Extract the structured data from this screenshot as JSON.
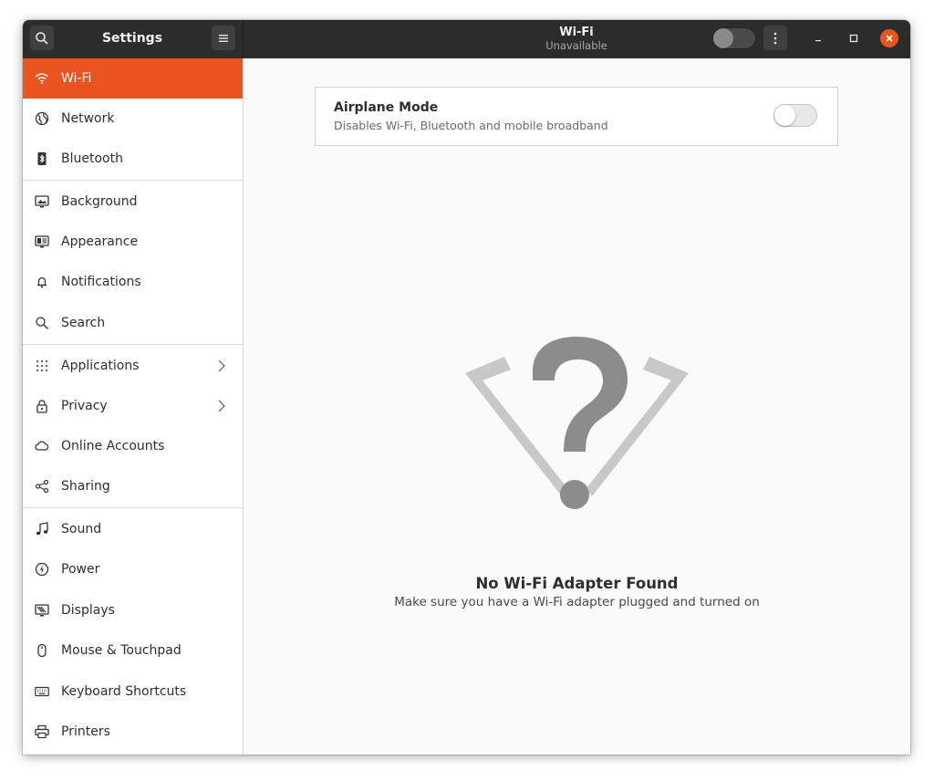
{
  "header": {
    "sidebar_title": "Settings",
    "title": "Wi-Fi",
    "subtitle": "Unavailable",
    "wifi_toggle_on": false,
    "icons": [
      "search-icon",
      "hamburger-menu-icon",
      "kebab-menu-icon",
      "minimize-icon",
      "maximize-icon",
      "close-icon"
    ]
  },
  "sidebar": {
    "active": "Wi-Fi",
    "accent_color": "#e95420",
    "items": [
      {
        "label": "Wi-Fi",
        "icon": "wifi-icon"
      },
      {
        "label": "Network",
        "icon": "network-globe-icon"
      },
      {
        "label": "Bluetooth",
        "icon": "bluetooth-icon"
      },
      {
        "label": "Background",
        "icon": "background-icon"
      },
      {
        "label": "Appearance",
        "icon": "appearance-icon"
      },
      {
        "label": "Notifications",
        "icon": "bell-icon"
      },
      {
        "label": "Search",
        "icon": "search-icon"
      },
      {
        "label": "Applications",
        "icon": "grid-icon"
      },
      {
        "label": "Privacy",
        "icon": "lock-icon"
      },
      {
        "label": "Online Accounts",
        "icon": "cloud-icon"
      },
      {
        "label": "Sharing",
        "icon": "share-icon"
      },
      {
        "label": "Sound",
        "icon": "music-note-icon"
      },
      {
        "label": "Power",
        "icon": "power-icon"
      },
      {
        "label": "Displays",
        "icon": "display-icon"
      },
      {
        "label": "Mouse & Touchpad",
        "icon": "mouse-icon"
      },
      {
        "label": "Keyboard Shortcuts",
        "icon": "keyboard-icon"
      },
      {
        "label": "Printers",
        "icon": "printer-icon"
      }
    ]
  },
  "airplane": {
    "title": "Airplane Mode",
    "description": "Disables Wi-Fi, Bluetooth and mobile broadband",
    "enabled": false
  },
  "empty_state": {
    "title": "No Wi-Fi Adapter Found",
    "message": "Make sure you have a Wi-Fi adapter plugged and turned on",
    "icon": "wifi-unknown-icon"
  }
}
